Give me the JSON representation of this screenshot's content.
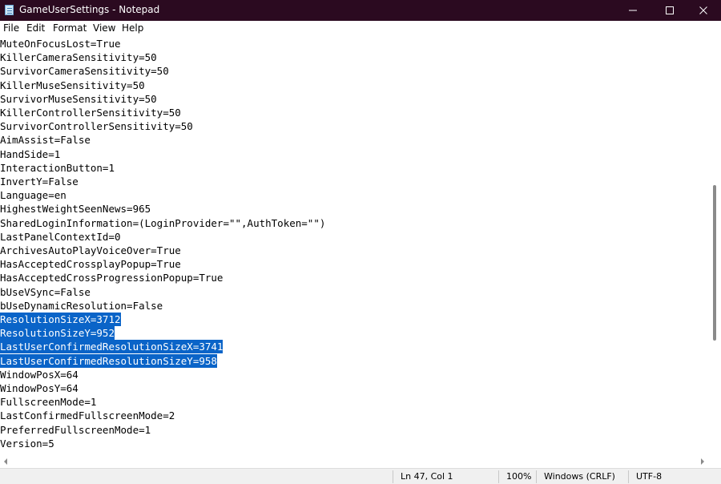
{
  "window": {
    "title": "GameUserSettings - Notepad",
    "colors": {
      "titlebar": "#2b0a20",
      "selection": "#0a64c8"
    }
  },
  "window_controls": {
    "icons": [
      "minimize-icon",
      "maximize-icon",
      "close-icon"
    ]
  },
  "menu": {
    "items": [
      "File",
      "Edit",
      "Format",
      "View",
      "Help"
    ]
  },
  "editor": {
    "lines": [
      "MuteOnFocusLost=True",
      "KillerCameraSensitivity=50",
      "SurvivorCameraSensitivity=50",
      "KillerMuseSensitivity=50",
      "SurvivorMuseSensitivity=50",
      "KillerControllerSensitivity=50",
      "SurvivorControllerSensitivity=50",
      "AimAssist=False",
      "HandSide=1",
      "InteractionButton=1",
      "InvertY=False",
      "Language=en",
      "HighestWeightSeenNews=965",
      "SharedLoginInformation=(LoginProvider=\"\",AuthToken=\"\")",
      "LastPanelContextId=0",
      "ArchivesAutoPlayVoiceOver=True",
      "HasAcceptedCrossplayPopup=True",
      "HasAcceptedCrossProgressionPopup=True",
      "bUseVSync=False",
      "bUseDynamicResolution=False",
      "ResolutionSizeX=3712",
      "ResolutionSizeY=952",
      "LastUserConfirmedResolutionSizeX=3741",
      "LastUserConfirmedResolutionSizeY=958",
      "WindowPosX=64",
      "WindowPosY=64",
      "FullscreenMode=1",
      "LastConfirmedFullscreenMode=2",
      "PreferredFullscreenMode=1",
      "Version=5"
    ],
    "selected_lines": [
      "ResolutionSizeX=3712",
      "ResolutionSizeY=952",
      "LastUserConfirmedResolutionSizeX=3741",
      "LastUserConfirmedResolutionSizeY=958"
    ]
  },
  "status": {
    "position": "Ln 47, Col 1",
    "zoom": "100%",
    "line_ending": "Windows (CRLF)",
    "encoding": "UTF-8"
  }
}
